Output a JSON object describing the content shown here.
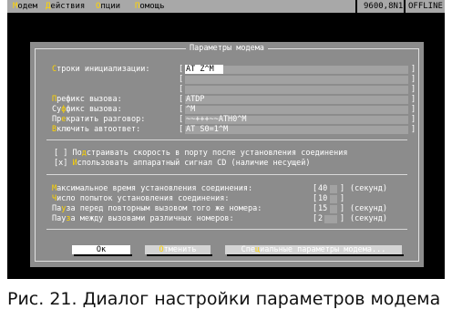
{
  "menubar": {
    "items": [
      {
        "hot": "М",
        "rest": "одем"
      },
      {
        "hot": "Д",
        "rest": "ействия"
      },
      {
        "hot": "О",
        "rest": "пции"
      },
      {
        "hot": "П",
        "rest": "омощь"
      }
    ],
    "status_speed": "9600,8N1",
    "status_online": "OFFLINE"
  },
  "dialog": {
    "title": "Параметры модема",
    "init_label": {
      "hot": "С",
      "rest": "троки инициализации:"
    },
    "init_lines": [
      "AT Z^M",
      "",
      ""
    ],
    "prefix_label": {
      "pre": "",
      "hot": "П",
      "rest": "рефикс вызова:"
    },
    "prefix_value": "ATDP",
    "suffix_label": {
      "pre": "Су",
      "hot": "ф",
      "rest": "фикс вызова:"
    },
    "suffix_value": "^M",
    "hangup_label": {
      "pre": "Пр",
      "hot": "е",
      "rest": "кратить разговор:"
    },
    "hangup_value": "~~+++~~ATH0^M",
    "autoanswer_label": {
      "pre": "",
      "hot": "В",
      "rest": "ключить автоответ:"
    },
    "autoanswer_value": "AT S0=1^M",
    "checkbox_adjust": {
      "box": "[ ]",
      "pre": "По",
      "hot": "д",
      "rest": "страивать скорость в порту после установления соединения"
    },
    "checkbox_cd": {
      "box": "[x]",
      "pre": "",
      "hot": "И",
      "rest": "спользовать аппаратный сигнал CD (наличие несущей)"
    },
    "max_time_label": {
      "pre": "",
      "hot": "М",
      "rest": "аксимальное время установления соединения:"
    },
    "max_time_value": "40",
    "max_time_unit": "(секунд)",
    "attempts_label": {
      "pre": "",
      "hot": "Ч",
      "rest": "исло попыток установления соединения:"
    },
    "attempts_value": "10",
    "pause_retry_label": {
      "pre": "Па",
      "hot": "у",
      "rest": "за перед повторным вызовом того же номера:"
    },
    "pause_retry_value": "15",
    "pause_retry_unit": "(секунд)",
    "pause_between_label": {
      "pre": "Пау",
      "hot": "з",
      "rest": "а между вызовами различных номеров:"
    },
    "pause_between_value": "2",
    "pause_between_unit": "(секунд)",
    "ok_label": "Ок",
    "cancel_label": {
      "hot": "О",
      "rest": "тменить"
    },
    "special_label": {
      "pre": "Спе",
      "hot": "ц",
      "rest": "иальные параметры модема..."
    }
  },
  "caption": "Рис. 21. Диалог настройки параметров модема",
  "colors": {
    "menubar": "#a8a8a8",
    "dialog": "#8c8c8c",
    "hotkey": "#ffd400",
    "desktop": "#000000"
  }
}
